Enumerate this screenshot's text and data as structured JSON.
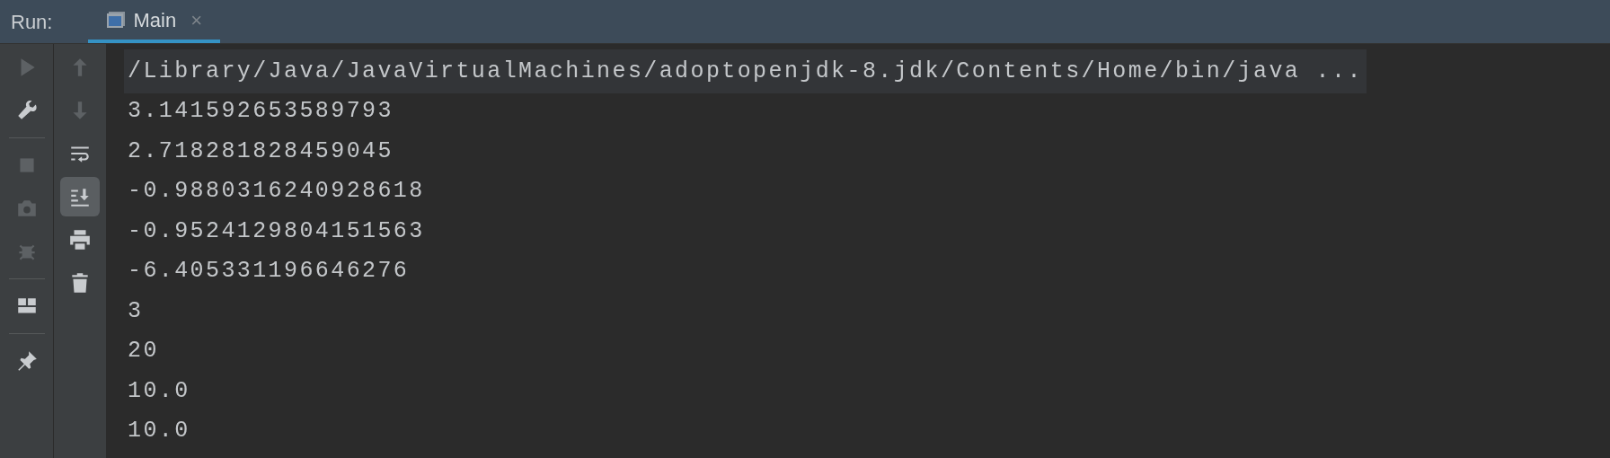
{
  "header": {
    "label": "Run:",
    "tabs": [
      {
        "label": "Main",
        "selected": true,
        "close": "×"
      }
    ]
  },
  "toolbar_left": [
    {
      "kind": "run",
      "disabled": true
    },
    {
      "kind": "wrench",
      "disabled": false
    },
    {
      "kind": "separator"
    },
    {
      "kind": "stop",
      "disabled": true
    },
    {
      "kind": "camera",
      "disabled": true
    },
    {
      "kind": "bug",
      "disabled": true
    },
    {
      "kind": "separator"
    },
    {
      "kind": "layout",
      "disabled": false
    },
    {
      "kind": "separator"
    },
    {
      "kind": "pin",
      "disabled": false
    }
  ],
  "toolbar_right": [
    {
      "kind": "up",
      "disabled": true,
      "selected": false
    },
    {
      "kind": "down",
      "disabled": true,
      "selected": false
    },
    {
      "kind": "wrap",
      "disabled": false,
      "selected": false
    },
    {
      "kind": "scroll-end",
      "disabled": false,
      "selected": true
    },
    {
      "kind": "print",
      "disabled": false,
      "selected": false
    },
    {
      "kind": "trash",
      "disabled": false,
      "selected": false
    }
  ],
  "console": {
    "lines": [
      {
        "text": "/Library/Java/JavaVirtualMachines/adoptopenjdk-8.jdk/Contents/Home/bin/java ...",
        "kind": "command"
      },
      {
        "text": "3.141592653589793",
        "kind": "output"
      },
      {
        "text": "2.718281828459045",
        "kind": "output"
      },
      {
        "text": "-0.9880316240928618",
        "kind": "output"
      },
      {
        "text": "-0.9524129804151563",
        "kind": "output"
      },
      {
        "text": "-6.405331196646276",
        "kind": "output"
      },
      {
        "text": "3",
        "kind": "output"
      },
      {
        "text": "20",
        "kind": "output"
      },
      {
        "text": "10.0",
        "kind": "output"
      },
      {
        "text": "10.0",
        "kind": "output"
      }
    ]
  }
}
